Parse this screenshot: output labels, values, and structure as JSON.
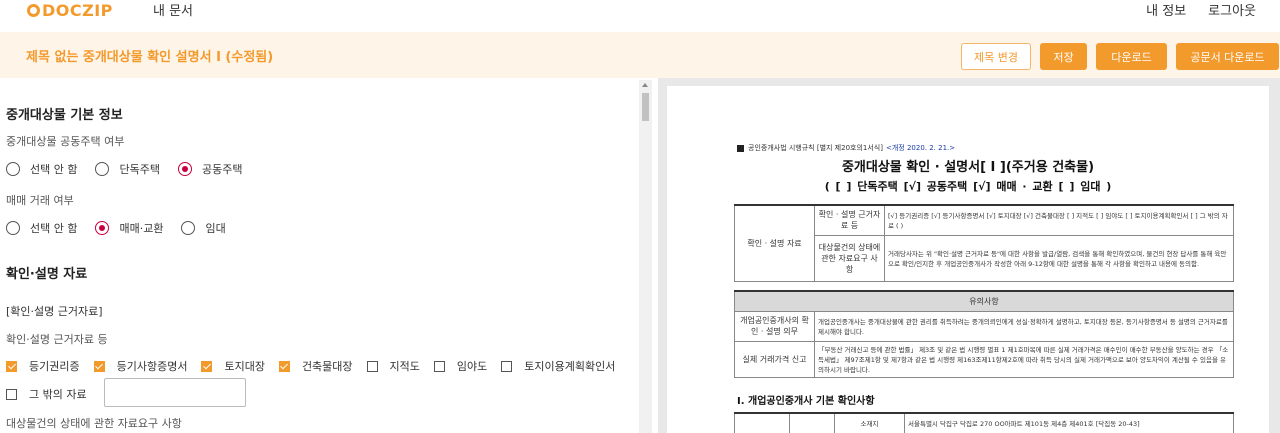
{
  "header": {
    "logo": "DOCZIP",
    "nav_my_docs": "내 문서",
    "nav_my_info": "내 정보",
    "nav_logout": "로그아웃"
  },
  "titlebar": {
    "title": "제목 없는 중개대상물 확인 설명서 I (수정됨)",
    "btn_rename": "제목 변경",
    "btn_save": "저장",
    "btn_download": "다운로드",
    "btn_official_download": "공문서 다운로드"
  },
  "colors": {
    "accent": "#f39a2c",
    "accent_light": "#fef4e8",
    "radio_selected": "#c7003f"
  },
  "form": {
    "section1_title": "중개대상물 기본 정보",
    "q_shared_house": "중개대상물 공동주택 여부",
    "shared_house_options": [
      {
        "label": "선택 안 함",
        "selected": false
      },
      {
        "label": "단독주택",
        "selected": false
      },
      {
        "label": "공동주택",
        "selected": true
      }
    ],
    "q_trade_type": "매매 거래 여부",
    "trade_options": [
      {
        "label": "선택 안 함",
        "selected": false
      },
      {
        "label": "매매·교환",
        "selected": true
      },
      {
        "label": "임대",
        "selected": false
      }
    ],
    "section2_title": "확인·설명 자료",
    "subsection_title": "[확인·설명 근거자료]",
    "q_basis": "확인·설명 근거자료 등",
    "basis_options": [
      {
        "label": "등기권리증",
        "checked": true
      },
      {
        "label": "등기사항증명서",
        "checked": true
      },
      {
        "label": "토지대장",
        "checked": true
      },
      {
        "label": "건축물대장",
        "checked": true
      },
      {
        "label": "지적도",
        "checked": false
      },
      {
        "label": "임야도",
        "checked": false
      },
      {
        "label": "토지이용계획확인서",
        "checked": false
      }
    ],
    "other_label": "그 밖의 자료",
    "other_checked": false,
    "q_request": "대상물건의 상태에 관한 자료요구 사항"
  },
  "preview": {
    "law_ref": "공인중개사법 시행규칙 [별지 제20호의1서식]",
    "law_rev": "<개정 2020. 2. 21.>",
    "title": "중개대상물 확인 · 설명서[ I ](주거용 건축물)",
    "subtitle": "( [ ] 단독주택 [√] 공동주택 [√] 매매 · 교환 [ ] 임대 )",
    "t1_label": "확인 · 설명 자료",
    "t1_row1_label": "확인 · 설명 근거자료 등",
    "t1_row1_value": "[√] 등기권리증 [√] 등기사항증명서 [√] 토지대장 [√] 건축물대장 [ ] 지적도 [ ] 임야도 [ ] 토지이용계획확인서 [ ] 그 밖의 자료 ( )",
    "t1_row2_label": "대상물건의 상태에 관한 자료요구 사항",
    "t1_row2_value": "거래당사자는 위 \"확인·설명 근거자료 등\"에 대한 사항을 발급/열람, 검색을 통해 확인하였으며, 물건의 현장 답사를 통해 육안으로 확인/인지한 후 개업공인중개사가 작성한 아래 9-12항에 대한 설명을 통해 각 사항을 확인하고 내용에 동의함.",
    "t2_header": "유의사항",
    "t2_row1_label": "개업공인중개사의 확인 · 설명 의무",
    "t2_row1_value": "개업공인중개사는 중개대상물에 관한 권리를 취득하려는 중개의뢰인에게 성실·정확하게 설명하고, 토지대장 등본, 등기사항증명서 등 설명의 근거자료를 제시해야 합니다.",
    "t2_row2_label": "실제 거래가격 신고",
    "t2_row2_value": "「부동산 거래신고 등에 관한 법률」 제3조 및 같은 법 시행령 별표 1 제1호마목에 따른 실제 거래가격은 매수인이 매수한 부동산을 양도하는 경우 「소득세법」 제97조제1항 및 제7항과 같은 법 시행령 제163조제11항제2호에 따라 취득 당시의 실제 거래가액으로 보아 양도차익이 계산될 수 있음을 유의하시기 바랍니다.",
    "section1": "Ⅰ. 개업공인중개사 기본 확인사항",
    "t3_label": "소재지",
    "t3_value": "서울특별시 닥집구 닥집로 270 OO아파트 제101동 제4층 제401호 [닥집동 20-43]"
  }
}
